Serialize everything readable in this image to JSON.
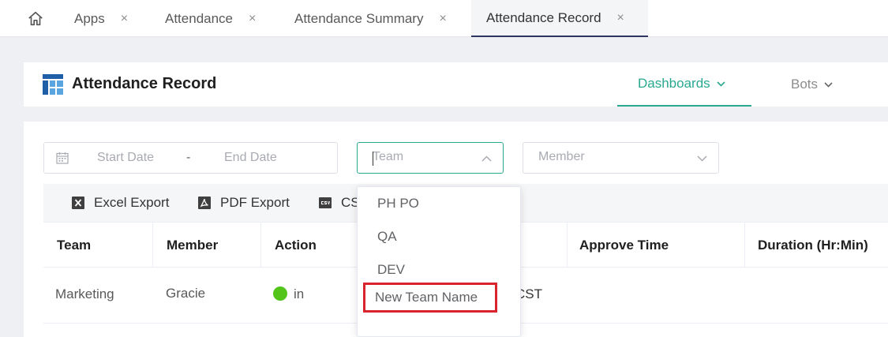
{
  "tabs": [
    {
      "label": "Apps"
    },
    {
      "label": "Attendance"
    },
    {
      "label": "Attendance Summary"
    },
    {
      "label": "Attendance Record"
    }
  ],
  "tab_close_glyph": "×",
  "header": {
    "title": "Attendance Record",
    "nav": [
      {
        "label": "Dashboards"
      },
      {
        "label": "Bots"
      }
    ]
  },
  "filters": {
    "start_placeholder": "Start Date",
    "separator": "-",
    "end_placeholder": "End Date",
    "team_placeholder": "Team",
    "member_placeholder": "Member"
  },
  "toolbar": {
    "excel": "Excel Export",
    "pdf": "PDF Export",
    "csv": "CS"
  },
  "table": {
    "columns": [
      "Team",
      "Member",
      "Action",
      "Approve Time",
      "Duration (Hr:Min)"
    ],
    "rows": [
      {
        "team": "Marketing",
        "member": "Gracie",
        "action": "in",
        "partial": "CST"
      }
    ]
  },
  "dropdown": {
    "options": [
      "PH PO",
      "QA",
      "DEV",
      "New Team Name"
    ]
  },
  "colors": {
    "accent": "#2aa88f",
    "active_tab_underline": "#2d3561",
    "highlight_box": "#d9232d",
    "status_in": "#52c41a"
  },
  "icons": {
    "home": "home-icon",
    "logo": "table-grid-icon",
    "calendar": "calendar-icon",
    "excel": "excel-icon",
    "pdf": "pdf-icon",
    "csv": "csv-icon"
  }
}
